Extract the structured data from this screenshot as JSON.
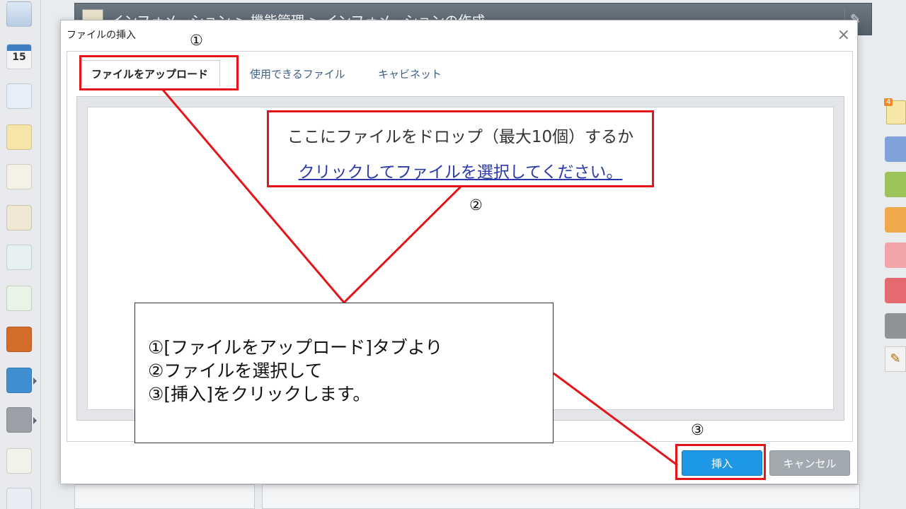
{
  "background": {
    "breadcrumb": "インフォメーション > 機能管理 > インフォメーションの作成"
  },
  "left_sidebar": {
    "calendar_day": "15"
  },
  "right_sidebar": {
    "notes_badge": "4"
  },
  "dialog": {
    "title": "ファイルの挿入",
    "close_label": "×",
    "tabs": [
      {
        "label": "ファイルをアップロード",
        "active": true
      },
      {
        "label": "使用できるファイル",
        "active": false
      },
      {
        "label": "キャビネット",
        "active": false
      }
    ],
    "drop_text": "ここにファイルをドロップ（最大10個）するか",
    "select_link": "クリックしてファイルを選択してください。",
    "insert_label": "挿入",
    "cancel_label": "キャンセル"
  },
  "annotation": {
    "marker1": "①",
    "marker2": "②",
    "marker3": "③",
    "callout_lines": [
      "①[ファイルをアップロード]タブより",
      "②ファイルを選択して",
      "③[挿入]をクリックします。"
    ]
  },
  "colors": {
    "highlight": "#e3151b",
    "primary_button": "#1e97e6",
    "secondary_button": "#a3a9b0",
    "link": "#2b3aa8"
  },
  "icons": {
    "close": "close-icon",
    "wrench": "wrench-icon",
    "pencil": "pencil-icon"
  }
}
